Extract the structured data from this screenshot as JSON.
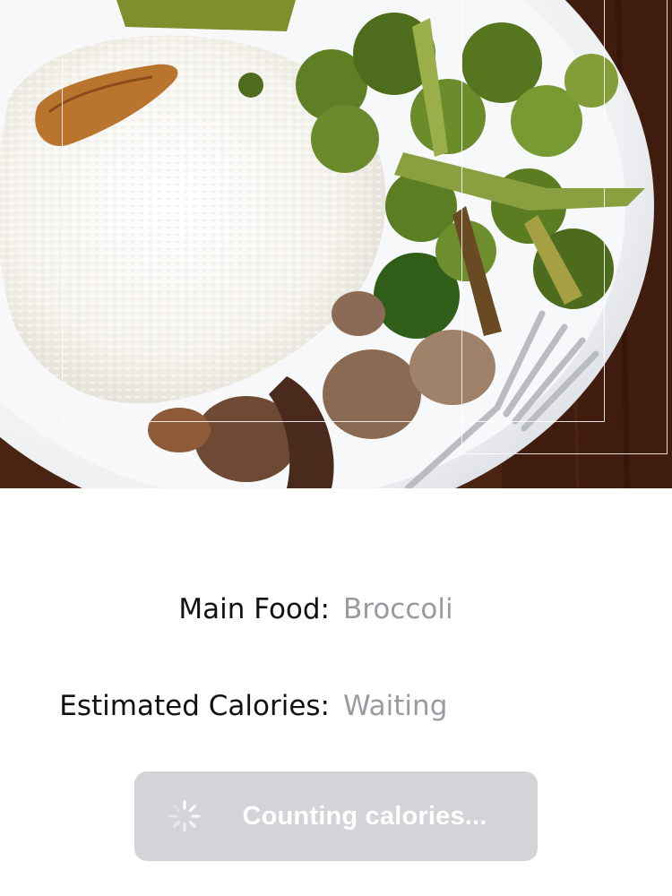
{
  "photo": {
    "subject": "plate of rice, broccoli and sausage",
    "detections": [
      {
        "name": "food-detection-box-main"
      },
      {
        "name": "food-detection-box-secondary"
      }
    ]
  },
  "info": {
    "main_food_label": "Main Food:",
    "main_food_value": "Broccoli",
    "calories_label": "Estimated Calories:",
    "calories_value": "Waiting"
  },
  "button": {
    "label": "Counting calories...",
    "state": "disabled-loading",
    "spinner_icon": "activity-spinner-icon"
  },
  "colors": {
    "label_text": "#111111",
    "value_text": "#9a9aa0",
    "button_bg": "#d4d4d8",
    "button_text": "#ffffff"
  }
}
